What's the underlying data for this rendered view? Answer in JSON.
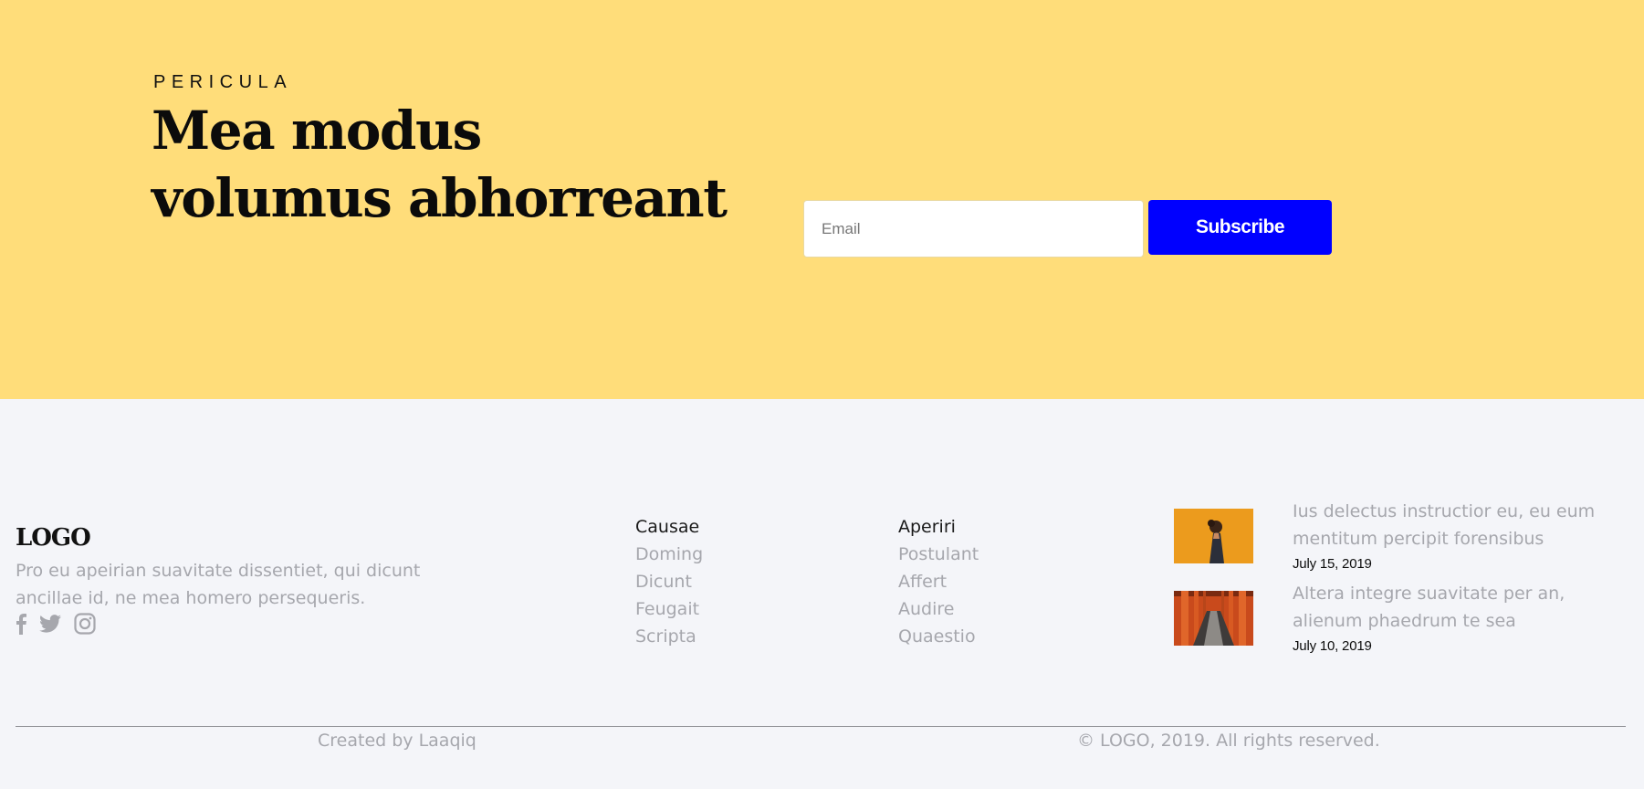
{
  "hero": {
    "eyebrow": "PERICULA",
    "headline": "Mea modus volumus abhorreant",
    "email_placeholder": "Email",
    "subscribe_label": "Subscribe",
    "background": "#ffdd7a",
    "button_color": "#0000ff"
  },
  "footer": {
    "logo": "LOGO",
    "about": "Pro eu apeirian suavitate dissentiet, qui dicunt ancillae id, ne mea homero persequeris.",
    "social": [
      "facebook-icon",
      "twitter-icon",
      "instagram-icon"
    ],
    "columns": [
      {
        "title": "Causae",
        "links": [
          "Doming",
          "Dicunt",
          "Feugait",
          "Scripta"
        ]
      },
      {
        "title": "Aperiri",
        "links": [
          "Postulant",
          "Affert",
          "Audire",
          "Quaestio"
        ]
      }
    ],
    "posts": [
      {
        "text": "Ius delectus instructior eu, eu eum mentitum percipit forensibus",
        "date": "July 15, 2019",
        "thumb": "woman-orange-wall-image"
      },
      {
        "text": "Altera integre suavitate per an, alienum phaedrum te sea",
        "date": "July 10, 2019",
        "thumb": "torii-gates-path-image"
      }
    ],
    "credit": "Created by Laaqiq",
    "copyright": "© LOGO, 2019. All rights reserved.",
    "background": "#f4f5f9"
  }
}
